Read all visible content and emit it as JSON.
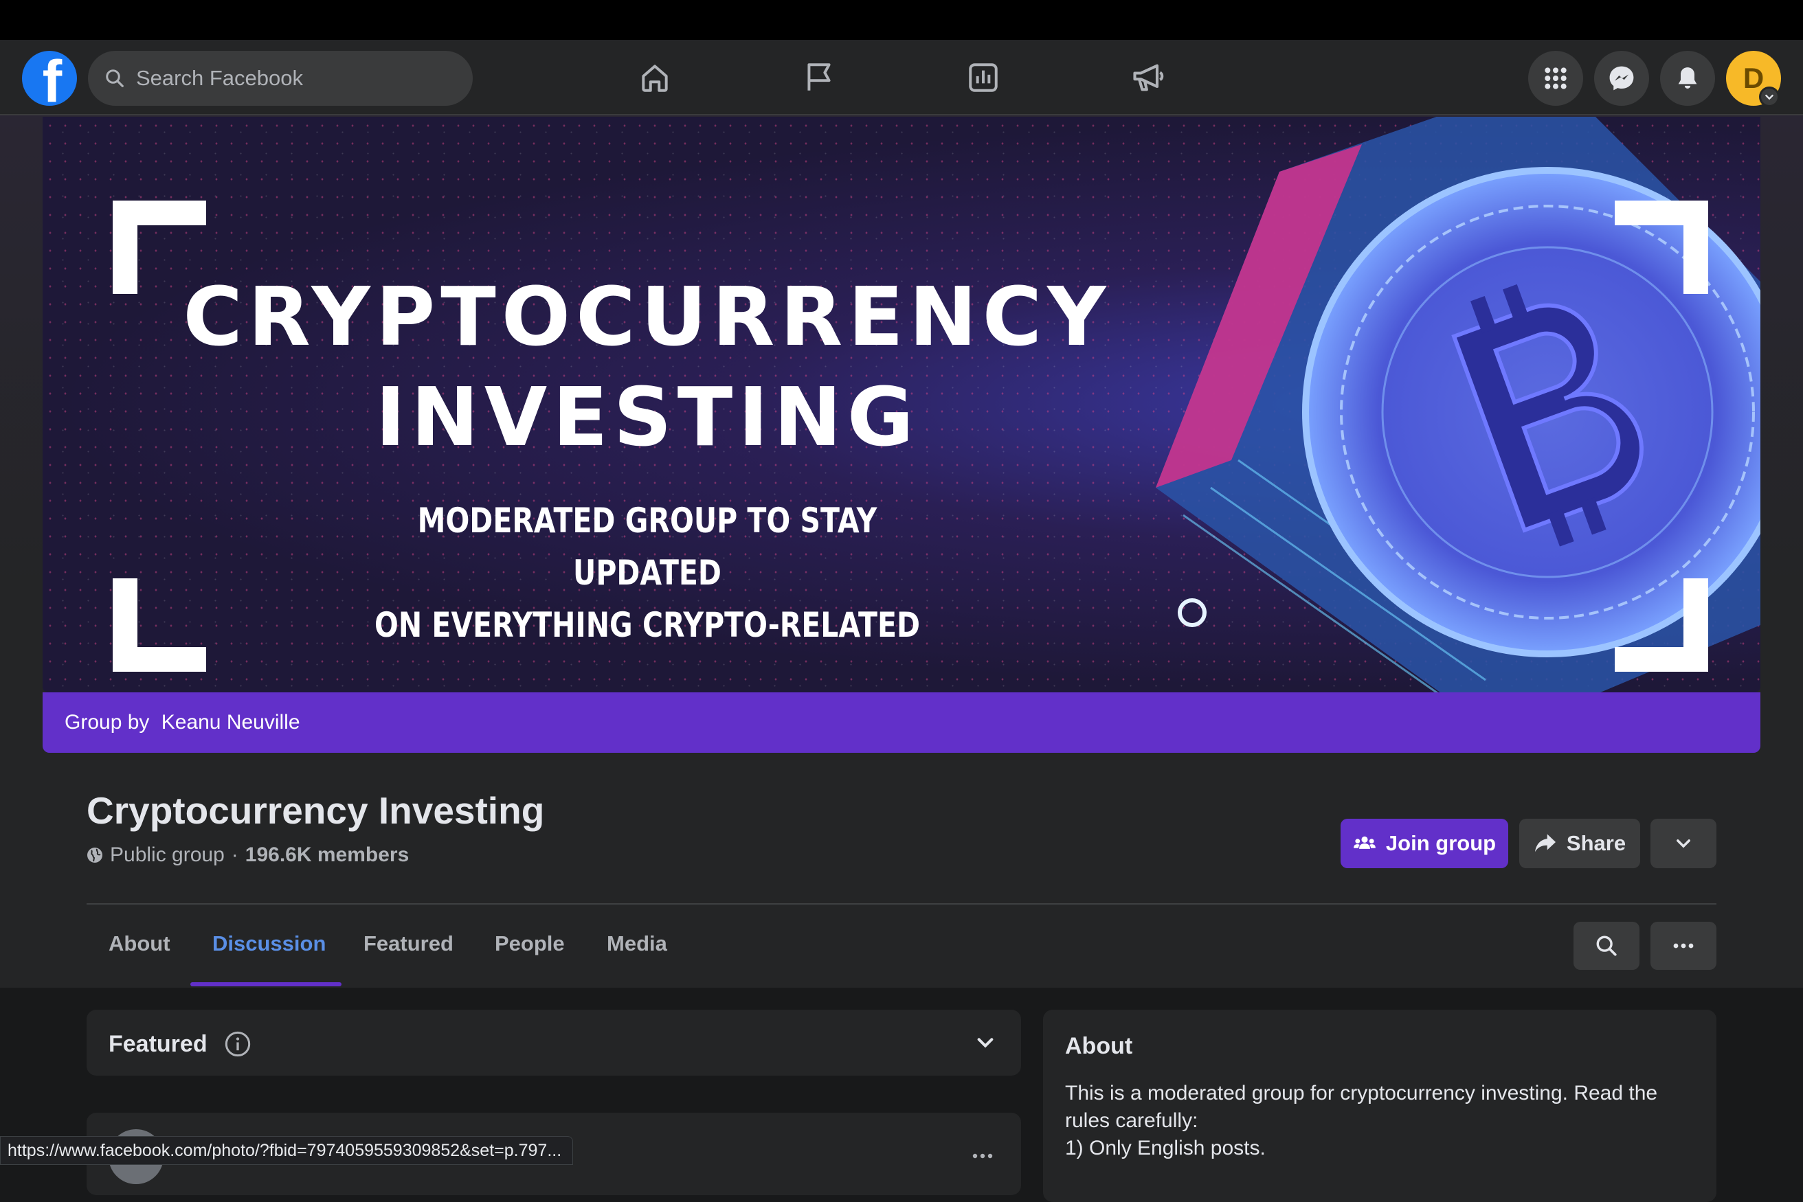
{
  "nav": {
    "search_placeholder": "Search Facebook",
    "logo_letter": "f",
    "icons": [
      "home-icon",
      "flag-icon",
      "stats-icon",
      "megaphone-icon"
    ],
    "right_buttons": [
      "menu-grid-icon",
      "messenger-icon",
      "bell-icon"
    ],
    "avatar_initial": "D"
  },
  "cover": {
    "title_line1": "CRYPTOCURRENCY",
    "title_line2": "INVESTING",
    "subtitle_line1": "MODERATED GROUP TO STAY UPDATED",
    "subtitle_line2": "ON EVERYTHING CRYPTO-RELATED",
    "group_by_prefix": "Group by ",
    "group_by_name": "Keanu Neuville"
  },
  "group": {
    "name": "Cryptocurrency Investing",
    "privacy": "Public group",
    "separator": "·",
    "members": "196.6K members"
  },
  "actions": {
    "join_label": "Join group",
    "share_label": "Share"
  },
  "tabs": [
    {
      "label": "About",
      "active": false
    },
    {
      "label": "Discussion",
      "active": true
    },
    {
      "label": "Featured",
      "active": false
    },
    {
      "label": "People",
      "active": false
    },
    {
      "label": "Media",
      "active": false
    }
  ],
  "featured": {
    "label": "Featured"
  },
  "about": {
    "title": "About",
    "text_line1": "This is a moderated group for cryptocurrency investing. Read the rules carefully:",
    "text_line2": "1) Only English posts."
  },
  "statusbar": {
    "url": "https://www.facebook.com/photo/?fbid=7974059559309852&set=p.797..."
  },
  "colors": {
    "accent": "#6230c9",
    "active_tab": "#5a8fe6",
    "facebook_blue": "#1877f2",
    "avatar": "#f7b928"
  }
}
